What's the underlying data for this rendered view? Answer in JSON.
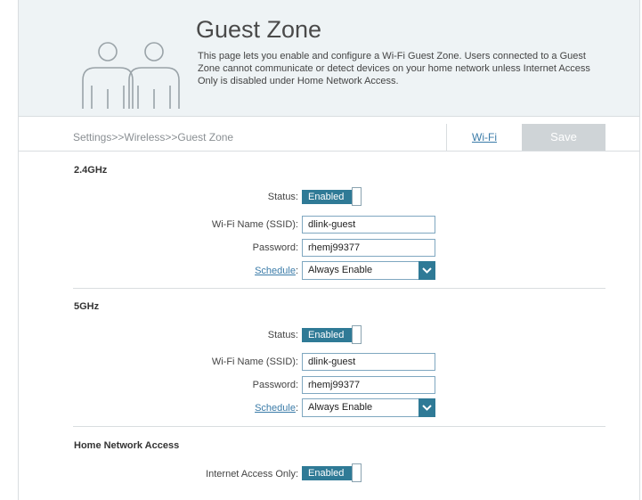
{
  "header": {
    "title": "Guest Zone",
    "description": "This page lets you enable and configure a Wi-Fi Guest Zone. Users connected to a Guest Zone cannot communicate or detect devices on your home network unless Internet Access Only is disabled under Home Network Access."
  },
  "nav": {
    "breadcrumb": "Settings>>Wireless>>Guest Zone",
    "wifi_link": "Wi-Fi",
    "save_label": "Save"
  },
  "band24": {
    "section_title": "2.4GHz",
    "status_label": "Status:",
    "status_value": "Enabled",
    "ssid_label": "Wi-Fi Name (SSID):",
    "ssid_value": "dlink-guest",
    "password_label": "Password:",
    "password_value": "rhemj99377",
    "schedule_label": "Schedule",
    "schedule_colon": ":",
    "schedule_value": "Always Enable"
  },
  "band5": {
    "section_title": "5GHz",
    "status_label": "Status:",
    "status_value": "Enabled",
    "ssid_label": "Wi-Fi Name (SSID):",
    "ssid_value": "dlink-guest",
    "password_label": "Password:",
    "password_value": "rhemj99377",
    "schedule_label": "Schedule",
    "schedule_colon": ":",
    "schedule_value": "Always Enable"
  },
  "home_network": {
    "section_title": "Home Network Access",
    "internet_only_label": "Internet Access Only:",
    "internet_only_value": "Enabled"
  },
  "colors": {
    "accent": "#2f7a96",
    "link": "#3a7ba8",
    "header_bg": "#eef3f5",
    "save_bg": "#cfd4d7"
  },
  "icons": {
    "header": "people-icon",
    "dropdown": "chevron-down-icon"
  }
}
